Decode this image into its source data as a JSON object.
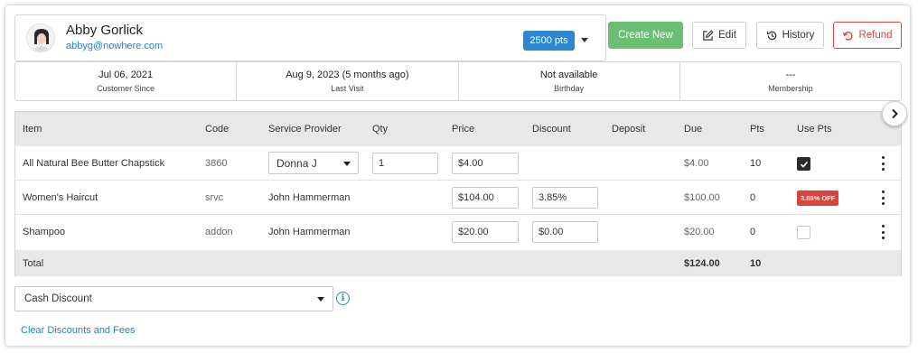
{
  "customer": {
    "name": "Abby Gorlick",
    "email": "abbyg@nowhere.com",
    "points": "2500 pts"
  },
  "actions": {
    "create_new": "Create New",
    "edit": "Edit",
    "history": "History",
    "refund": "Refund"
  },
  "info": [
    {
      "value": "Jul 06, 2021",
      "label": "Customer Since"
    },
    {
      "value": "Aug 9, 2023 (5 months ago)",
      "label": "Last Visit"
    },
    {
      "value": "Not available",
      "label": "Birthday"
    },
    {
      "value": "---",
      "label": "Membership"
    }
  ],
  "table": {
    "headers": [
      "Item",
      "Code",
      "Service Provider",
      "Qty",
      "Price",
      "Discount",
      "Deposit",
      "Due",
      "Pts",
      "Use Pts"
    ],
    "rows": [
      {
        "item": "All Natural Bee Butter Chapstick",
        "code": "3860",
        "provider": "Donna J",
        "qty": "1",
        "price": "$4.00",
        "discount": "",
        "deposit": "",
        "due": "$4.00",
        "pts": "10",
        "use_pts": "checked"
      },
      {
        "item": "Women's Haircut",
        "code": "srvc",
        "provider": "John Hammerman",
        "qty": "",
        "price": "$104.00",
        "discount": "3.85%",
        "deposit": "",
        "due": "$100.00",
        "pts": "0",
        "use_pts": "3.85% OFF"
      },
      {
        "item": "Shampoo",
        "code": "addon",
        "provider": "John Hammerman",
        "qty": "",
        "price": "$20.00",
        "discount": "$0.00",
        "deposit": "",
        "due": "$20.00",
        "pts": "0",
        "use_pts": "unchecked"
      }
    ],
    "total": {
      "label": "Total",
      "due": "$124.00",
      "pts": "10"
    }
  },
  "discount_select": {
    "value": "Cash Discount"
  },
  "clear_link": "Clear Discounts and Fees",
  "colors": {
    "primary": "#2a87d0",
    "create": "#6bbf75",
    "refund": "#d9443f",
    "off_badge": "#d9443f",
    "link": "#2a7fc1"
  },
  "icons": {
    "edit": "pencil-square-icon",
    "history": "history-clock-icon",
    "refund": "undo-arrow-icon",
    "next": "chevron-right-icon",
    "info": "info-icon"
  }
}
